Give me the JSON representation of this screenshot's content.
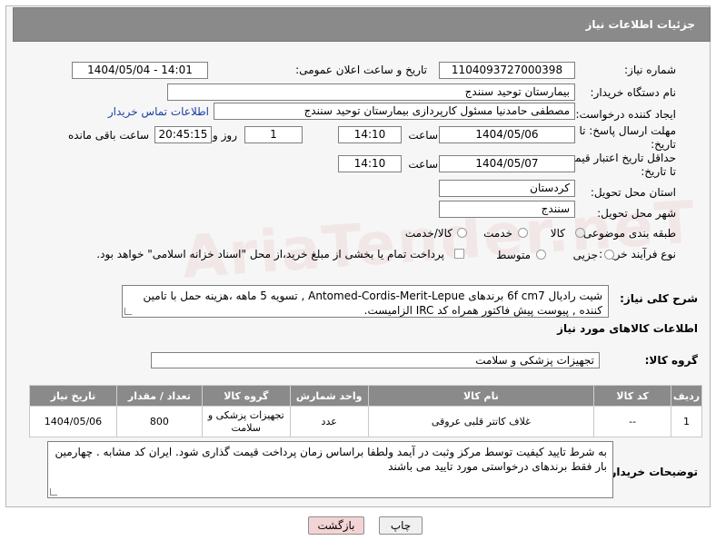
{
  "header": {
    "title": "جزئیات اطلاعات نیاز"
  },
  "watermark": "AriaTender.neT",
  "fields": {
    "need_number_label": "شماره نیاز:",
    "need_number": "1104093727000398",
    "announce_label": "تاریخ و ساعت اعلان عمومی:",
    "announce_value": "1404/05/04 - 14:01",
    "buyer_org_label": "نام دستگاه خریدار:",
    "buyer_org": "بیمارستان توحید سنندج",
    "requester_label": "ایجاد کننده درخواست:",
    "requester": "مصطفی حامدنیا مسئول کارپردازی بیمارستان توحید سنندج",
    "buyer_contact_link": "اطلاعات تماس خریدار",
    "deadline_label_1": "مهلت ارسال پاسخ: تا",
    "deadline_label_2": "تاریخ:",
    "deadline_date": "1404/05/06",
    "time_label": "ساعت",
    "deadline_time": "14:10",
    "days_value": "1",
    "days_label": "روز و",
    "remaining_value": "20:45:15",
    "remaining_label": "ساعت باقی مانده",
    "validity_label_1": "حداقل تاریخ اعتبار قیمت:",
    "validity_label_2": "تا تاریخ:",
    "validity_date": "1404/05/07",
    "validity_time": "14:10",
    "province_label": "استان محل تحویل:",
    "province": "کردستان",
    "city_label": "شهر محل تحویل:",
    "city": "سنندج",
    "category_label": "طبقه بندی موضوعی:",
    "category_options": [
      "کالا",
      "خدمت",
      "کالا/خدمت"
    ],
    "process_label": "نوع فرآیند خرید :",
    "process_options": [
      "جزیی",
      "متوسط"
    ],
    "payment_note": "پرداخت تمام یا بخشی از مبلغ خرید،از محل \"اسناد خزانه اسلامی\" خواهد بود."
  },
  "description": {
    "label": "شرح کلی نیاز:",
    "text": "شیت رادیال 6f cm7 برندهای Antomed-Cordis-Merit-Lepue , تسویه 5 ماهه ،هزینه حمل با تامین کننده , پیوست پیش فاکتور همراه کد IRC  الزامیست."
  },
  "goods_section": {
    "title": "اطلاعات کالاهای مورد نیاز",
    "group_label": "گروه کالا:",
    "group_value": "تجهیزات پزشکی و سلامت"
  },
  "table": {
    "headers": [
      "ردیف",
      "کد کالا",
      "نام کالا",
      "واحد شمارش",
      "گروه کالا",
      "تعداد / مقدار",
      "تاریخ نیاز"
    ],
    "rows": [
      [
        "1",
        "--",
        "غلاف کاتتر قلبی عروقی",
        "عدد",
        "تجهیزات پزشکی و سلامت",
        "800",
        "1404/05/06"
      ]
    ]
  },
  "buyer_notes": {
    "label": "توضیحات خریدار:",
    "text": "به شرط تایید کیفیت توسط مرکز وثبت در آیمد ولطفا براساس زمان پرداخت   قیمت گذاری شود. ایران کد مشابه . چهارمین بار فقط برندهای درخواستی مورد تایید می باشند"
  },
  "buttons": {
    "print": "چاپ",
    "back": "بازگشت"
  },
  "colors": {
    "header_bg": "#8a8a8a",
    "link": "#1a3fa6",
    "back_btn_bg": "#f3d4d4"
  }
}
